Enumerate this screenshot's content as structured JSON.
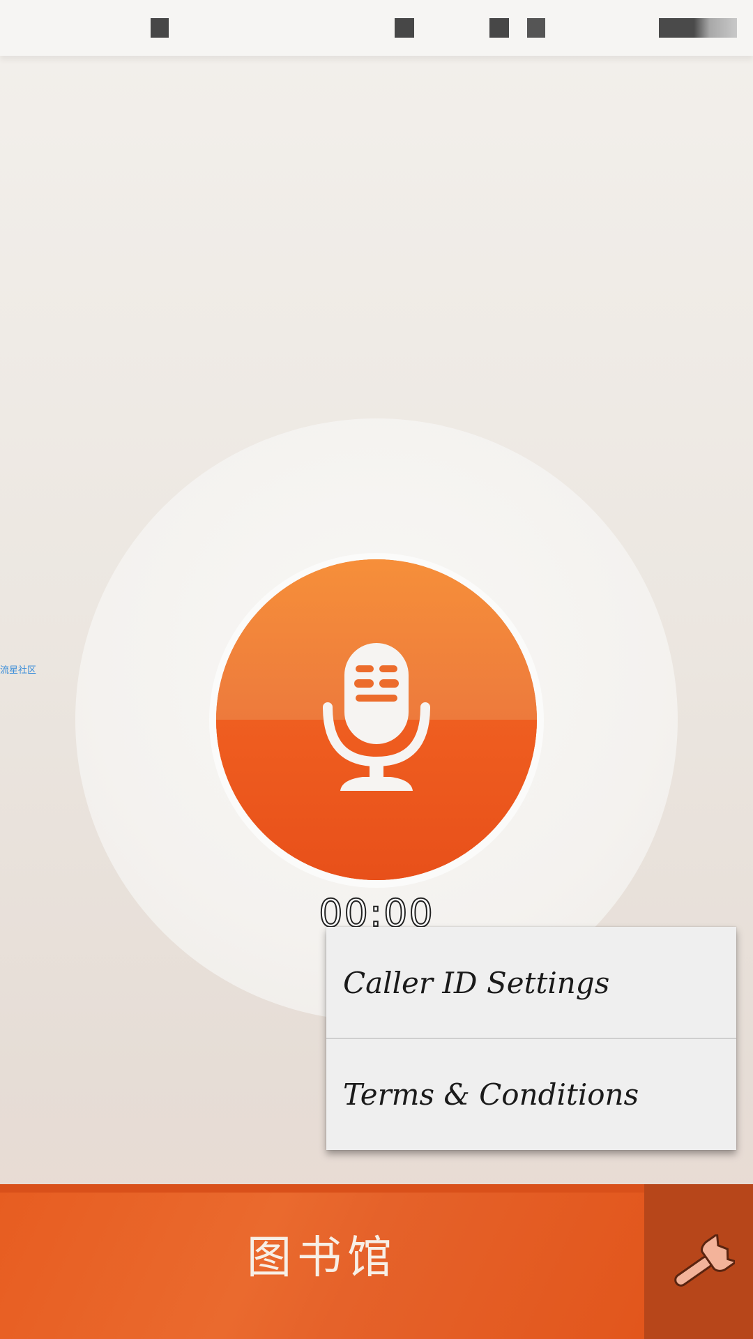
{
  "side_tag": "流星社区",
  "timer": "00:00",
  "popup_menu": {
    "items": [
      {
        "label": "Caller ID Settings"
      },
      {
        "label": "Terms & Conditions"
      }
    ]
  },
  "bottom_bar": {
    "library_label": "图书馆"
  },
  "colors": {
    "accent": "#ee6a28",
    "settings_bg": "#b7461a"
  },
  "icons": {
    "record": "microphone-icon",
    "settings": "wrench-icon"
  }
}
